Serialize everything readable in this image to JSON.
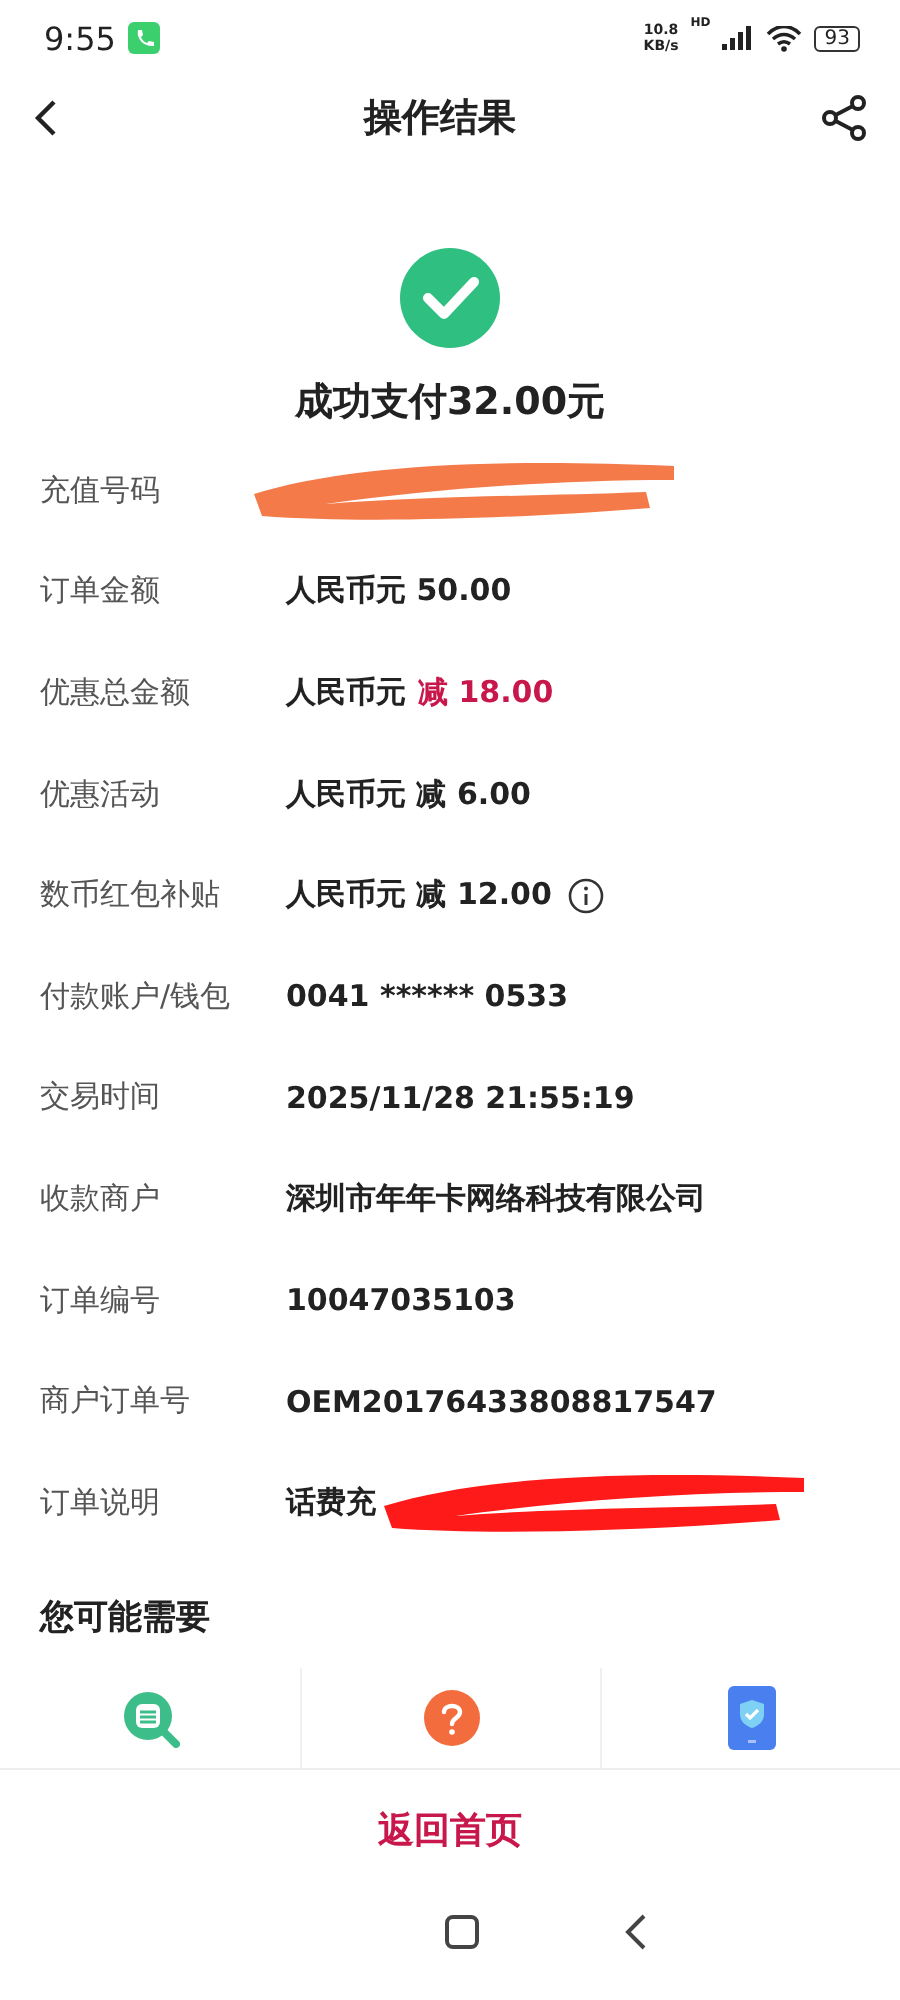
{
  "status_bar": {
    "time": "9:55",
    "speed": "10.8",
    "speed_unit": "KB/s",
    "network": "HD",
    "battery": "93"
  },
  "header": {
    "title": "操作结果"
  },
  "result": {
    "title": "成功支付32.00元"
  },
  "rows": [
    {
      "label": "充值号码",
      "value": "",
      "color": "#f47a4a"
    },
    {
      "label": "订单金额",
      "value": "人民币元 50.00"
    },
    {
      "label": "优惠总金额",
      "value": "人民币元",
      "accent": "减 18.00"
    },
    {
      "label": "优惠活动",
      "value": "人民币元 减 6.00"
    },
    {
      "label": "数币红包补贴",
      "value": "人民币元 减 12.00",
      "info": true
    },
    {
      "label": "付款账户/钱包",
      "value": "0041 ****** 0533"
    },
    {
      "label": "交易时间",
      "value": "2025/11/28 21:55:19"
    },
    {
      "label": "收款商户",
      "value": "深圳市年年卡网络科技有限公司"
    },
    {
      "label": "订单编号",
      "value": "10047035103"
    },
    {
      "label": "商户订单号",
      "value": "OEM20176433808817547"
    },
    {
      "label": "订单说明",
      "value": "话费充",
      "color": "#ff1a1a"
    }
  ],
  "suggestions": {
    "title": "您可能需要",
    "items": [
      {
        "kind": "search"
      },
      {
        "kind": "help"
      },
      {
        "kind": "phone"
      }
    ]
  },
  "footer": {
    "button": "返回首页"
  }
}
